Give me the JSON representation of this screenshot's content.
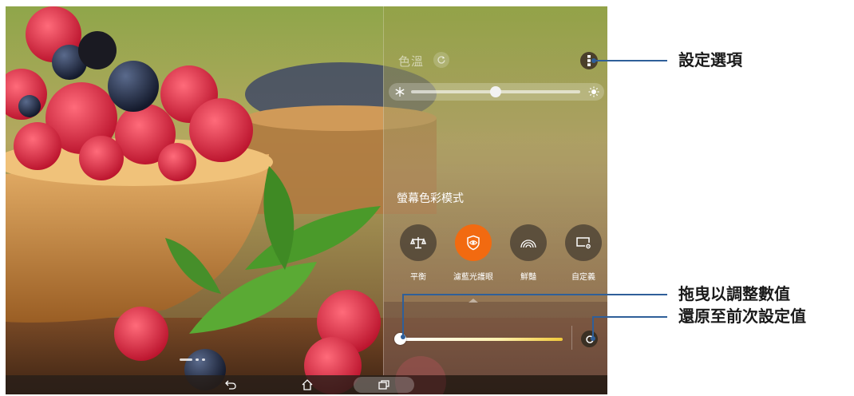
{
  "panel": {
    "color_temp_label": "色溫",
    "mode_title": "螢幕色彩模式",
    "modes": [
      {
        "label": "平衡",
        "icon": "balance-scale-icon",
        "active": false
      },
      {
        "label": "濾藍光護眼",
        "icon": "eye-shield-icon",
        "active": true
      },
      {
        "label": "鮮豔",
        "icon": "rainbow-icon",
        "active": false
      },
      {
        "label": "自定義",
        "icon": "custom-settings-icon",
        "active": false
      }
    ],
    "accent_color": "#f26a10"
  },
  "nav": {
    "items": [
      "back-icon",
      "home-icon",
      "recent-apps-icon"
    ]
  },
  "callouts": {
    "settings": "設定選項",
    "drag": "拖曳以調整數值",
    "reset": "還原至前次設定值",
    "line_color": "#2f5f99"
  }
}
